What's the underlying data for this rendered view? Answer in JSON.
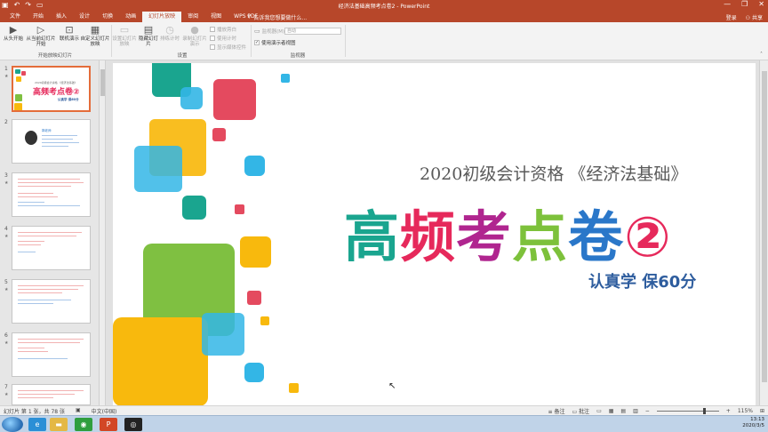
{
  "window": {
    "title": "经济法基础高频考点卷2 - PowerPoint",
    "qat_icons": [
      "save-icon",
      "undo-icon",
      "redo-icon",
      "start-slideshow-icon"
    ],
    "controls": {
      "minimize": "—",
      "restore": "❐",
      "close": "✕"
    }
  },
  "tabs": [
    {
      "label": "文件",
      "active": false
    },
    {
      "label": "开始",
      "active": false
    },
    {
      "label": "插入",
      "active": false
    },
    {
      "label": "设计",
      "active": false
    },
    {
      "label": "切换",
      "active": false
    },
    {
      "label": "动画",
      "active": false
    },
    {
      "label": "幻灯片放映",
      "active": true
    },
    {
      "label": "审阅",
      "active": false
    },
    {
      "label": "视图",
      "active": false
    },
    {
      "label": "WPS PDF",
      "active": false
    }
  ],
  "tell_me": "告诉我您想要做什么...",
  "account": {
    "login": "登录",
    "share": "共享"
  },
  "ribbon": {
    "from_beginning": "从头开始",
    "from_current": "从当前幻灯片开始",
    "present_online": "联机演示",
    "custom_show": "自定义幻灯片放映",
    "group_start": "开始放映幻灯片",
    "setup_show": "设置幻灯片放映",
    "hide_slide": "隐藏幻灯片",
    "rehearse": "排练计时",
    "record": "录制幻灯片演示",
    "play_narrations": "播放旁白",
    "use_timings": "使用计时",
    "show_media": "显示媒体控件",
    "group_setup": "设置",
    "monitor_label": "监视器(M):",
    "monitor_value": "自动",
    "presenter_view": "使用演示者视图",
    "group_monitor": "监视器"
  },
  "thumbnails": [
    {
      "num": "1",
      "selected": true
    },
    {
      "num": "2",
      "selected": false
    },
    {
      "num": "3",
      "selected": false
    },
    {
      "num": "4",
      "selected": false
    },
    {
      "num": "5",
      "selected": false
    },
    {
      "num": "6",
      "selected": false
    },
    {
      "num": "7",
      "selected": false
    }
  ],
  "thumb_content": {
    "t1_sub": "2020初级会计资格 《经济法基础》",
    "t1_title": "高频考点卷②",
    "t1_tag": "认真学 保60分",
    "t2_name": "郭老师"
  },
  "slide": {
    "subtitle": "2020初级会计资格 《经济法基础》",
    "title_chars": [
      {
        "ch": "高",
        "color": "#1aa58f"
      },
      {
        "ch": "频",
        "color": "#e6295b"
      },
      {
        "ch": "考",
        "color": "#b0258f"
      },
      {
        "ch": "点",
        "color": "#7dc13b"
      },
      {
        "ch": "卷",
        "color": "#2a77c9"
      },
      {
        "ch": "②",
        "color": "#e6295b"
      }
    ],
    "tagline": "认真学 保60分",
    "colors": {
      "teal": "#1aa58f",
      "red": "#e44a5f",
      "yellow": "#f8b90d",
      "blue": "#33b6e6",
      "green": "#7fc041",
      "orange": "#f7a417"
    }
  },
  "status": {
    "slide_info": "幻灯片 第 1 张，共 78 张",
    "language": "中文(中国)",
    "notes": "备注",
    "comments": "批注",
    "zoom": "115%"
  },
  "taskbar": {
    "apps": [
      "ie-icon",
      "explorer-icon",
      "media-icon",
      "powerpoint-icon",
      "recorder-icon"
    ],
    "time": "13:13",
    "date": "2020/3/5"
  }
}
